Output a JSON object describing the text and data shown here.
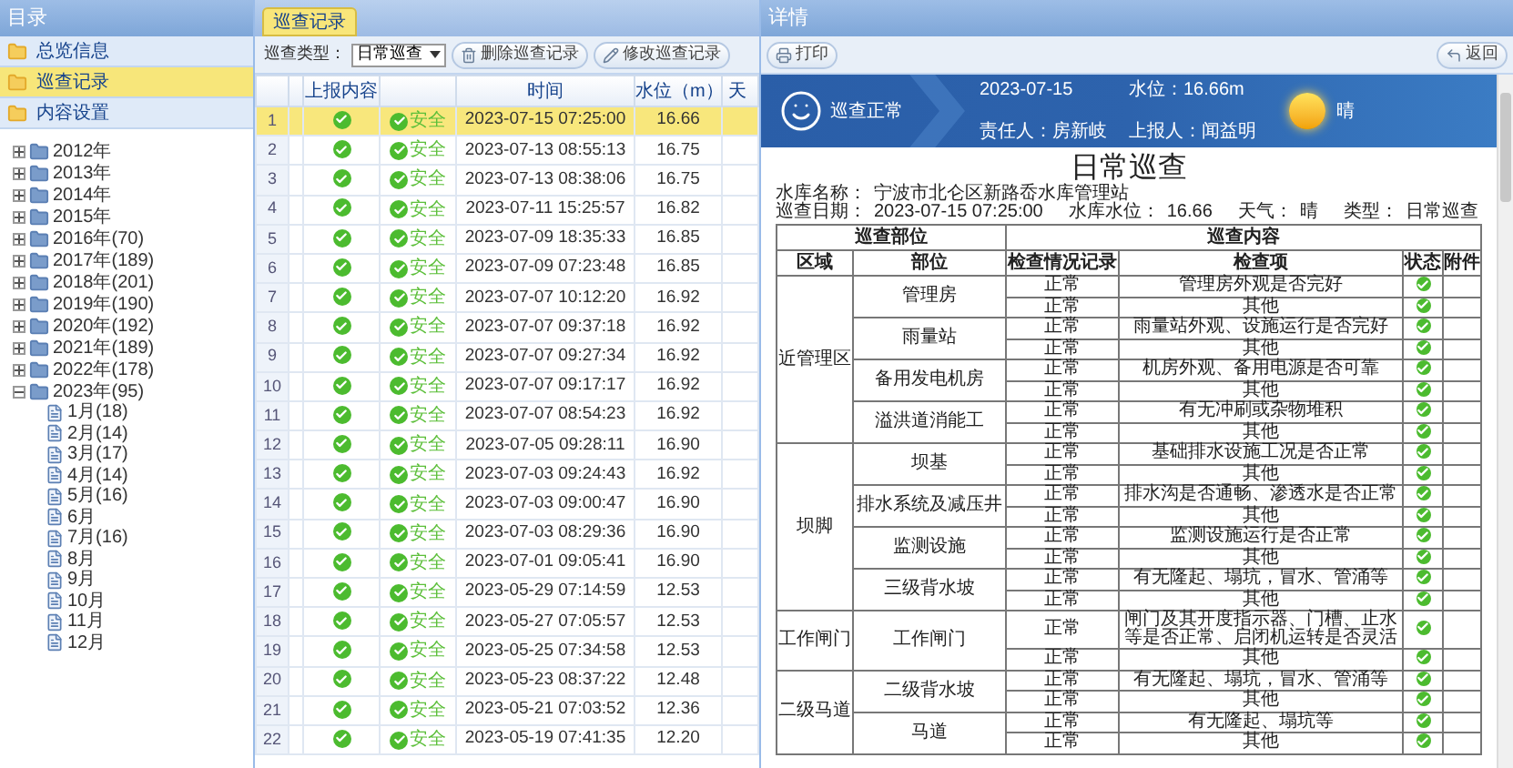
{
  "sidebar": {
    "title": "目录",
    "sections": [
      {
        "label": "总览信息",
        "selected": false
      },
      {
        "label": "巡查记录",
        "selected": true
      },
      {
        "label": "内容设置",
        "selected": false
      }
    ],
    "tree": [
      {
        "label": "2012年",
        "expanded": false
      },
      {
        "label": "2013年",
        "expanded": false
      },
      {
        "label": "2014年",
        "expanded": false
      },
      {
        "label": "2015年",
        "expanded": false
      },
      {
        "label": "2016年(70)",
        "expanded": false
      },
      {
        "label": "2017年(189)",
        "expanded": false
      },
      {
        "label": "2018年(201)",
        "expanded": false
      },
      {
        "label": "2019年(190)",
        "expanded": false
      },
      {
        "label": "2020年(192)",
        "expanded": false
      },
      {
        "label": "2021年(189)",
        "expanded": false
      },
      {
        "label": "2022年(178)",
        "expanded": false
      },
      {
        "label": "2023年(95)",
        "expanded": true,
        "children": [
          {
            "label": "1月(18)"
          },
          {
            "label": "2月(14)"
          },
          {
            "label": "3月(17)"
          },
          {
            "label": "4月(14)"
          },
          {
            "label": "5月(16)"
          },
          {
            "label": "6月"
          },
          {
            "label": "7月(16)"
          },
          {
            "label": "8月"
          },
          {
            "label": "9月"
          },
          {
            "label": "10月"
          },
          {
            "label": "11月"
          },
          {
            "label": "12月"
          }
        ]
      }
    ]
  },
  "records": {
    "tab": "巡查记录",
    "filter_label": "巡查类型：",
    "filter_value": "日常巡查",
    "buttons": [
      {
        "kind": "delete",
        "label": "删除巡查记录"
      },
      {
        "kind": "edit",
        "label": "修改巡查记录"
      }
    ],
    "columns": [
      "上报内容",
      "时间",
      "水位（m）",
      "天"
    ],
    "rows": [
      {
        "index": "1",
        "reported": true,
        "safe": true,
        "status": "安全",
        "time": "2023-07-15 07:25:00",
        "level_m": "16.66",
        "selected": true
      },
      {
        "index": "2",
        "reported": true,
        "safe": true,
        "status": "安全",
        "time": "2023-07-13 08:55:13",
        "level_m": "16.75",
        "selected": false
      },
      {
        "index": "3",
        "reported": true,
        "safe": true,
        "status": "安全",
        "time": "2023-07-13 08:38:06",
        "level_m": "16.75",
        "selected": false
      },
      {
        "index": "4",
        "reported": true,
        "safe": true,
        "status": "安全",
        "time": "2023-07-11 15:25:57",
        "level_m": "16.82",
        "selected": false
      },
      {
        "index": "5",
        "reported": true,
        "safe": true,
        "status": "安全",
        "time": "2023-07-09 18:35:33",
        "level_m": "16.85",
        "selected": false
      },
      {
        "index": "6",
        "reported": true,
        "safe": true,
        "status": "安全",
        "time": "2023-07-09 07:23:48",
        "level_m": "16.85",
        "selected": false
      },
      {
        "index": "7",
        "reported": true,
        "safe": true,
        "status": "安全",
        "time": "2023-07-07 10:12:20",
        "level_m": "16.92",
        "selected": false
      },
      {
        "index": "8",
        "reported": true,
        "safe": true,
        "status": "安全",
        "time": "2023-07-07 09:37:18",
        "level_m": "16.92",
        "selected": false
      },
      {
        "index": "9",
        "reported": true,
        "safe": true,
        "status": "安全",
        "time": "2023-07-07 09:27:34",
        "level_m": "16.92",
        "selected": false
      },
      {
        "index": "10",
        "reported": true,
        "safe": true,
        "status": "安全",
        "time": "2023-07-07 09:17:17",
        "level_m": "16.92",
        "selected": false
      },
      {
        "index": "11",
        "reported": true,
        "safe": true,
        "status": "安全",
        "time": "2023-07-07 08:54:23",
        "level_m": "16.92",
        "selected": false
      },
      {
        "index": "12",
        "reported": true,
        "safe": true,
        "status": "安全",
        "time": "2023-07-05 09:28:11",
        "level_m": "16.90",
        "selected": false
      },
      {
        "index": "13",
        "reported": true,
        "safe": true,
        "status": "安全",
        "time": "2023-07-03 09:24:43",
        "level_m": "16.92",
        "selected": false
      },
      {
        "index": "14",
        "reported": true,
        "safe": true,
        "status": "安全",
        "time": "2023-07-03 09:00:47",
        "level_m": "16.90",
        "selected": false
      },
      {
        "index": "15",
        "reported": true,
        "safe": true,
        "status": "安全",
        "time": "2023-07-03 08:29:36",
        "level_m": "16.90",
        "selected": false
      },
      {
        "index": "16",
        "reported": true,
        "safe": true,
        "status": "安全",
        "time": "2023-07-01 09:05:41",
        "level_m": "16.90",
        "selected": false
      },
      {
        "index": "17",
        "reported": true,
        "safe": true,
        "status": "安全",
        "time": "2023-05-29 07:14:59",
        "level_m": "12.53",
        "selected": false
      },
      {
        "index": "18",
        "reported": true,
        "safe": true,
        "status": "安全",
        "time": "2023-05-27 07:05:57",
        "level_m": "12.53",
        "selected": false
      },
      {
        "index": "19",
        "reported": true,
        "safe": true,
        "status": "安全",
        "time": "2023-05-25 07:34:58",
        "level_m": "12.53",
        "selected": false
      },
      {
        "index": "20",
        "reported": true,
        "safe": true,
        "status": "安全",
        "time": "2023-05-23 08:37:22",
        "level_m": "12.48",
        "selected": false
      },
      {
        "index": "21",
        "reported": true,
        "safe": true,
        "status": "安全",
        "time": "2023-05-21 07:03:52",
        "level_m": "12.36",
        "selected": false
      },
      {
        "index": "22",
        "reported": true,
        "safe": true,
        "status": "安全",
        "time": "2023-05-19 07:41:35",
        "level_m": "12.20",
        "selected": false
      }
    ]
  },
  "detail": {
    "title": "详情",
    "buttons": [
      {
        "kind": "print",
        "label": "打印"
      },
      {
        "kind": "back",
        "label": "返回"
      }
    ],
    "banner": {
      "status": "巡查正常",
      "date": "2023-07-15",
      "water_level": "水位：16.66m",
      "responsible": "责任人：房新岐",
      "reporter": "上报人：闻益明",
      "weather": "晴"
    },
    "report": {
      "title": "日常巡查",
      "info": [
        [
          {
            "label": "水库名称：",
            "value": "宁波市北仑区新路岙水库管理站"
          }
        ],
        [
          {
            "label": "巡查日期：",
            "value": "2023-07-15 07:25:00"
          },
          {
            "label": "水库水位：",
            "value": "16.66"
          },
          {
            "label": "天气：",
            "value": "晴"
          },
          {
            "label": "类型：",
            "value": "日常巡查"
          }
        ]
      ],
      "group_headers": [
        "巡查部位",
        "巡查内容"
      ],
      "columns": [
        "区域",
        "部位",
        "检查情况记录",
        "检查项",
        "状态",
        "附件"
      ],
      "regions": [
        {
          "name": "近管理区",
          "parts": [
            {
              "name": "管理房",
              "checks": [
                {
                  "record": "正常",
                  "item": "管理房外观是否完好",
                  "ok": true
                },
                {
                  "record": "正常",
                  "item": "其他",
                  "ok": true
                }
              ]
            },
            {
              "name": "雨量站",
              "checks": [
                {
                  "record": "正常",
                  "item": "雨量站外观、设施运行是否完好",
                  "ok": true
                },
                {
                  "record": "正常",
                  "item": "其他",
                  "ok": true
                }
              ]
            },
            {
              "name": "备用发电机房",
              "checks": [
                {
                  "record": "正常",
                  "item": "机房外观、备用电源是否可靠",
                  "ok": true
                },
                {
                  "record": "正常",
                  "item": "其他",
                  "ok": true
                }
              ]
            },
            {
              "name": "溢洪道消能工",
              "checks": [
                {
                  "record": "正常",
                  "item": "有无冲刷或杂物堆积",
                  "ok": true
                },
                {
                  "record": "正常",
                  "item": "其他",
                  "ok": true
                }
              ]
            }
          ]
        },
        {
          "name": "坝脚",
          "parts": [
            {
              "name": "坝基",
              "checks": [
                {
                  "record": "正常",
                  "item": "基础排水设施工况是否正常",
                  "ok": true
                },
                {
                  "record": "正常",
                  "item": "其他",
                  "ok": true
                }
              ]
            },
            {
              "name": "排水系统及减压井",
              "checks": [
                {
                  "record": "正常",
                  "item": "排水沟是否通畅、渗透水是否正常",
                  "ok": true
                },
                {
                  "record": "正常",
                  "item": "其他",
                  "ok": true
                }
              ]
            },
            {
              "name": "监测设施",
              "checks": [
                {
                  "record": "正常",
                  "item": "监测设施运行是否正常",
                  "ok": true
                },
                {
                  "record": "正常",
                  "item": "其他",
                  "ok": true
                }
              ]
            },
            {
              "name": "三级背水坡",
              "checks": [
                {
                  "record": "正常",
                  "item": "有无隆起、塌坑，冒水、管涌等",
                  "ok": true
                },
                {
                  "record": "正常",
                  "item": "其他",
                  "ok": true
                }
              ]
            }
          ]
        },
        {
          "name": "工作闸门",
          "parts": [
            {
              "name": "工作闸门",
              "checks": [
                {
                  "record": "正常",
                  "item": "闸门及其开度指示器、门槽、止水等是否正常、启闭机运转是否灵活",
                  "ok": true
                },
                {
                  "record": "正常",
                  "item": "其他",
                  "ok": true
                }
              ]
            }
          ]
        },
        {
          "name": "二级马道",
          "parts": [
            {
              "name": "二级背水坡",
              "checks": [
                {
                  "record": "正常",
                  "item": "有无隆起、塌坑，冒水、管涌等",
                  "ok": true
                },
                {
                  "record": "正常",
                  "item": "其他",
                  "ok": true
                }
              ]
            },
            {
              "name": "马道",
              "checks": [
                {
                  "record": "正常",
                  "item": "有无隆起、塌坑等",
                  "ok": true
                },
                {
                  "record": "正常",
                  "item": "其他",
                  "ok": true
                }
              ]
            }
          ]
        }
      ]
    }
  }
}
